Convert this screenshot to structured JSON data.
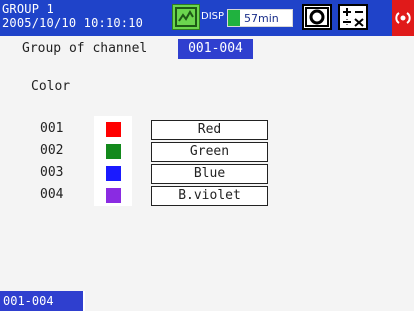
{
  "header": {
    "group_label": "GROUP 1",
    "datetime": "2005/10/10 10:10:10",
    "disp_label": "DISP",
    "remaining_time": "57min",
    "remaining_fraction": 0.18,
    "icons": [
      "memory-icon",
      "camera-snapshot-icon",
      "math-icon",
      "alarm-icon"
    ],
    "colors": {
      "bar_bg": "#1f43c9",
      "memory": "#6bd64e",
      "alarm": "#e01a1a"
    }
  },
  "form": {
    "group_label": "Group of channel",
    "group_value": "001-004",
    "color_label": "Color"
  },
  "channels": [
    {
      "number": "001",
      "color_name": "Red",
      "color": "#ff0000"
    },
    {
      "number": "002",
      "color_name": "Green",
      "color": "#13891c"
    },
    {
      "number": "003",
      "color_name": "Blue",
      "color": "#1a1aff"
    },
    {
      "number": "004",
      "color_name": "B.violet",
      "color": "#8a2be2"
    }
  ],
  "footer": {
    "tab_label": "001-004"
  }
}
